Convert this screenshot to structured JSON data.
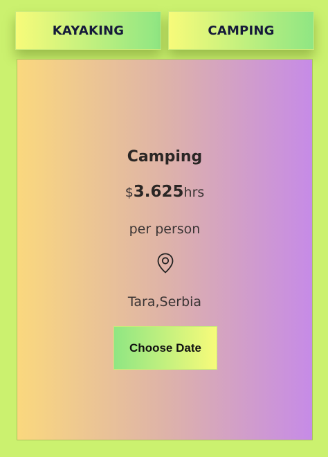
{
  "tabs": [
    {
      "label": "KAYAKING"
    },
    {
      "label": "CAMPING"
    }
  ],
  "card": {
    "title": "Camping",
    "price": {
      "currency": "$",
      "amount": "3.625",
      "unit": "hrs"
    },
    "per_person": "per person",
    "location_icon": "map-pin-icon",
    "location": "Tara,Serbia",
    "button_label": "Choose Date"
  },
  "colors": {
    "page_background": "#cbf16f",
    "tab_gradient_start": "#f7fb7a",
    "tab_gradient_end": "#8fe683",
    "card_gradient_start": "#fad87e",
    "card_gradient_end": "#c68be7",
    "tab_text": "#151a3a"
  }
}
